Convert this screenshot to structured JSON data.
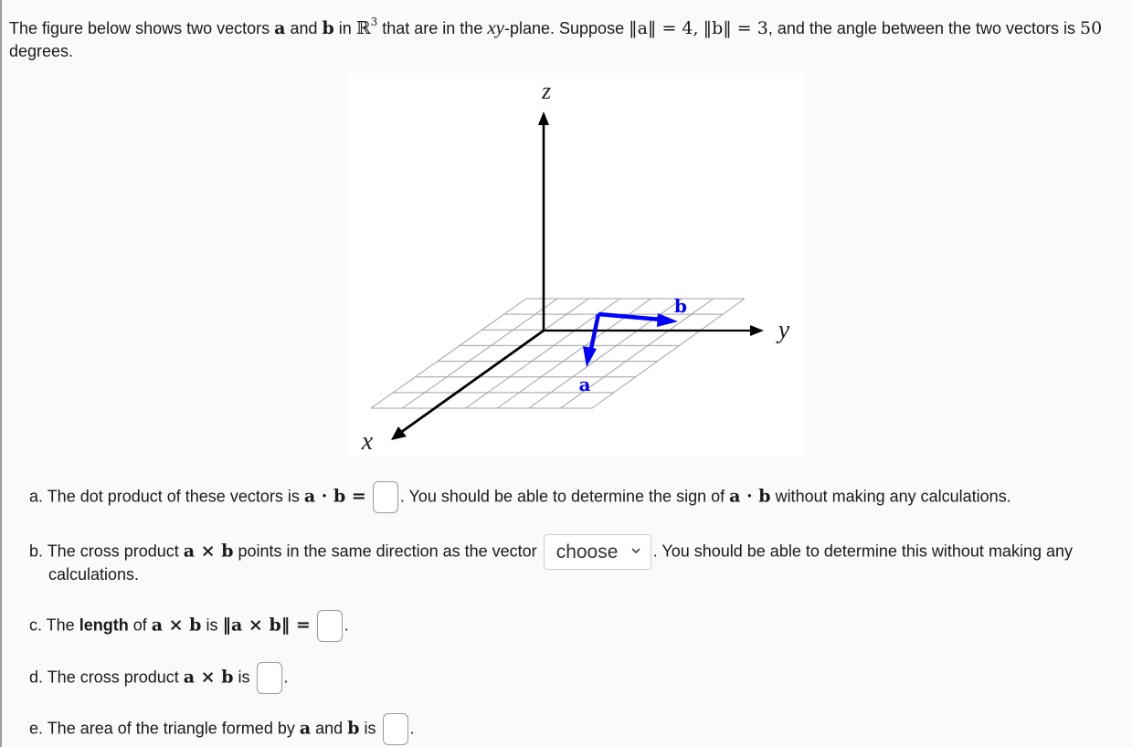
{
  "intro": {
    "t1": "The figure below shows two vectors ",
    "a": "a",
    "t2": " and ",
    "b": "b",
    "t3": " in ",
    "R": "ℝ",
    "R_sup": "3",
    "t4": " that are in the ",
    "xy": "xy",
    "t5": "-plane. Suppose ",
    "norm_a": "‖a‖ = 4,",
    "norm_b": "‖b‖ = 3",
    "t6": ", and the angle between the two vectors is ",
    "angle": "50",
    "t7": " degrees."
  },
  "figure": {
    "axis_labels": {
      "x": "x",
      "y": "y",
      "z": "z"
    },
    "vector_labels": {
      "a": "a",
      "b": "b"
    },
    "vector_color": "#0000ff",
    "grid_rows": 7,
    "grid_cols": 7
  },
  "questions": {
    "a": {
      "prefix": "a. The dot product of these vectors is ",
      "math": "a · b =",
      "suffix": ". You should be able to determine the sign of ",
      "math2": "a · b",
      "suffix2": " without making any calculations.",
      "answer_value": ""
    },
    "b": {
      "prefix": "b. The cross product ",
      "math": "a × b",
      "mid": " points in the same direction as the vector ",
      "select_value": "choose",
      "suffix": ". You should be able to determine this without making any",
      "line2": "calculations."
    },
    "c": {
      "prefix": "c. The ",
      "bold": "length",
      "mid": " of ",
      "math": "a × b",
      "mid2": " is ",
      "math2": "‖a × b‖ =",
      "suffix": ".",
      "answer_value": ""
    },
    "d": {
      "prefix": "d. The cross product ",
      "math": "a × b",
      "mid": " is ",
      "suffix": ".",
      "answer_value": ""
    },
    "e": {
      "prefix": "e. The area of the triangle formed by ",
      "a": "a",
      "mid": " and ",
      "b": "b",
      "mid2": " is ",
      "suffix": ".",
      "answer_value": ""
    }
  }
}
